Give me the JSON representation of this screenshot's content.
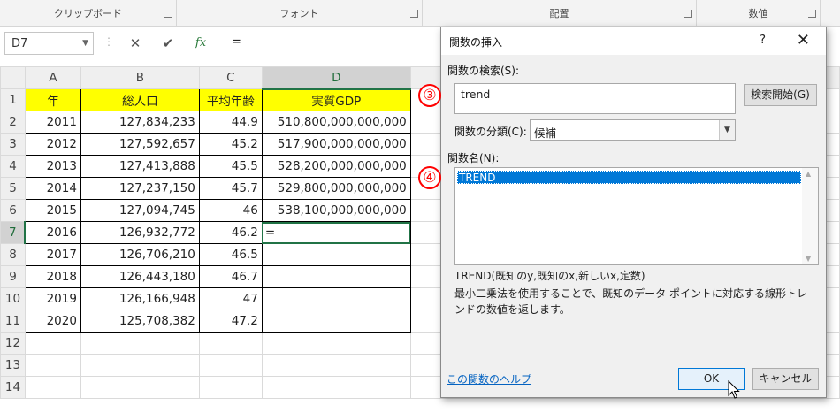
{
  "ribbon": {
    "groups": [
      {
        "label": "クリップボード"
      },
      {
        "label": "フォント"
      },
      {
        "label": "配置"
      },
      {
        "label": "数値"
      }
    ]
  },
  "formula_bar": {
    "name_box": "D7",
    "cancel_icon": "✕",
    "enter_icon": "✔",
    "fx_icon": "fx",
    "formula": "="
  },
  "sheet": {
    "columns": [
      "A",
      "B",
      "C",
      "D"
    ],
    "rows": [
      "1",
      "2",
      "3",
      "4",
      "5",
      "6",
      "7",
      "8",
      "9",
      "10",
      "11",
      "12",
      "13",
      "14"
    ],
    "headers": [
      "年",
      "総人口",
      "平均年齢",
      "実質GDP"
    ],
    "data": [
      [
        "2011",
        "127,834,233",
        "44.9",
        "510,800,000,000,000"
      ],
      [
        "2012",
        "127,592,657",
        "45.2",
        "517,900,000,000,000"
      ],
      [
        "2013",
        "127,413,888",
        "45.5",
        "528,200,000,000,000"
      ],
      [
        "2014",
        "127,237,150",
        "45.7",
        "529,800,000,000,000"
      ],
      [
        "2015",
        "127,094,745",
        "46",
        "538,100,000,000,000"
      ],
      [
        "2016",
        "126,932,772",
        "46.2",
        "="
      ],
      [
        "2017",
        "126,706,210",
        "46.5",
        ""
      ],
      [
        "2018",
        "126,443,180",
        "46.7",
        ""
      ],
      [
        "2019",
        "126,166,948",
        "47",
        ""
      ],
      [
        "2020",
        "125,708,382",
        "47.2",
        ""
      ]
    ]
  },
  "dialog": {
    "title": "関数の挿入",
    "help": "?",
    "close": "✕",
    "search_label": "関数の検索(S):",
    "search_value": "trend",
    "search_button": "検索開始(G)",
    "category_label": "関数の分類(C):",
    "category_value": "候補",
    "list_label": "関数名(N):",
    "selected_function": "TREND",
    "syntax": "TREND(既知のy,既知のx,新しいx,定数)",
    "description": "最小二乗法を使用することで、既知のデータ ポイントに対応する線形トレンドの数値を返します。",
    "help_link": "この関数のヘルプ",
    "ok": "OK",
    "cancel": "キャンセル"
  },
  "annotations": [
    "③",
    "④"
  ],
  "colors": {
    "header_fill": "#ffff00",
    "selection_green": "#217346",
    "list_selection": "#0078d7",
    "annotation_red": "#ff0000",
    "link_blue": "#0563c1"
  }
}
